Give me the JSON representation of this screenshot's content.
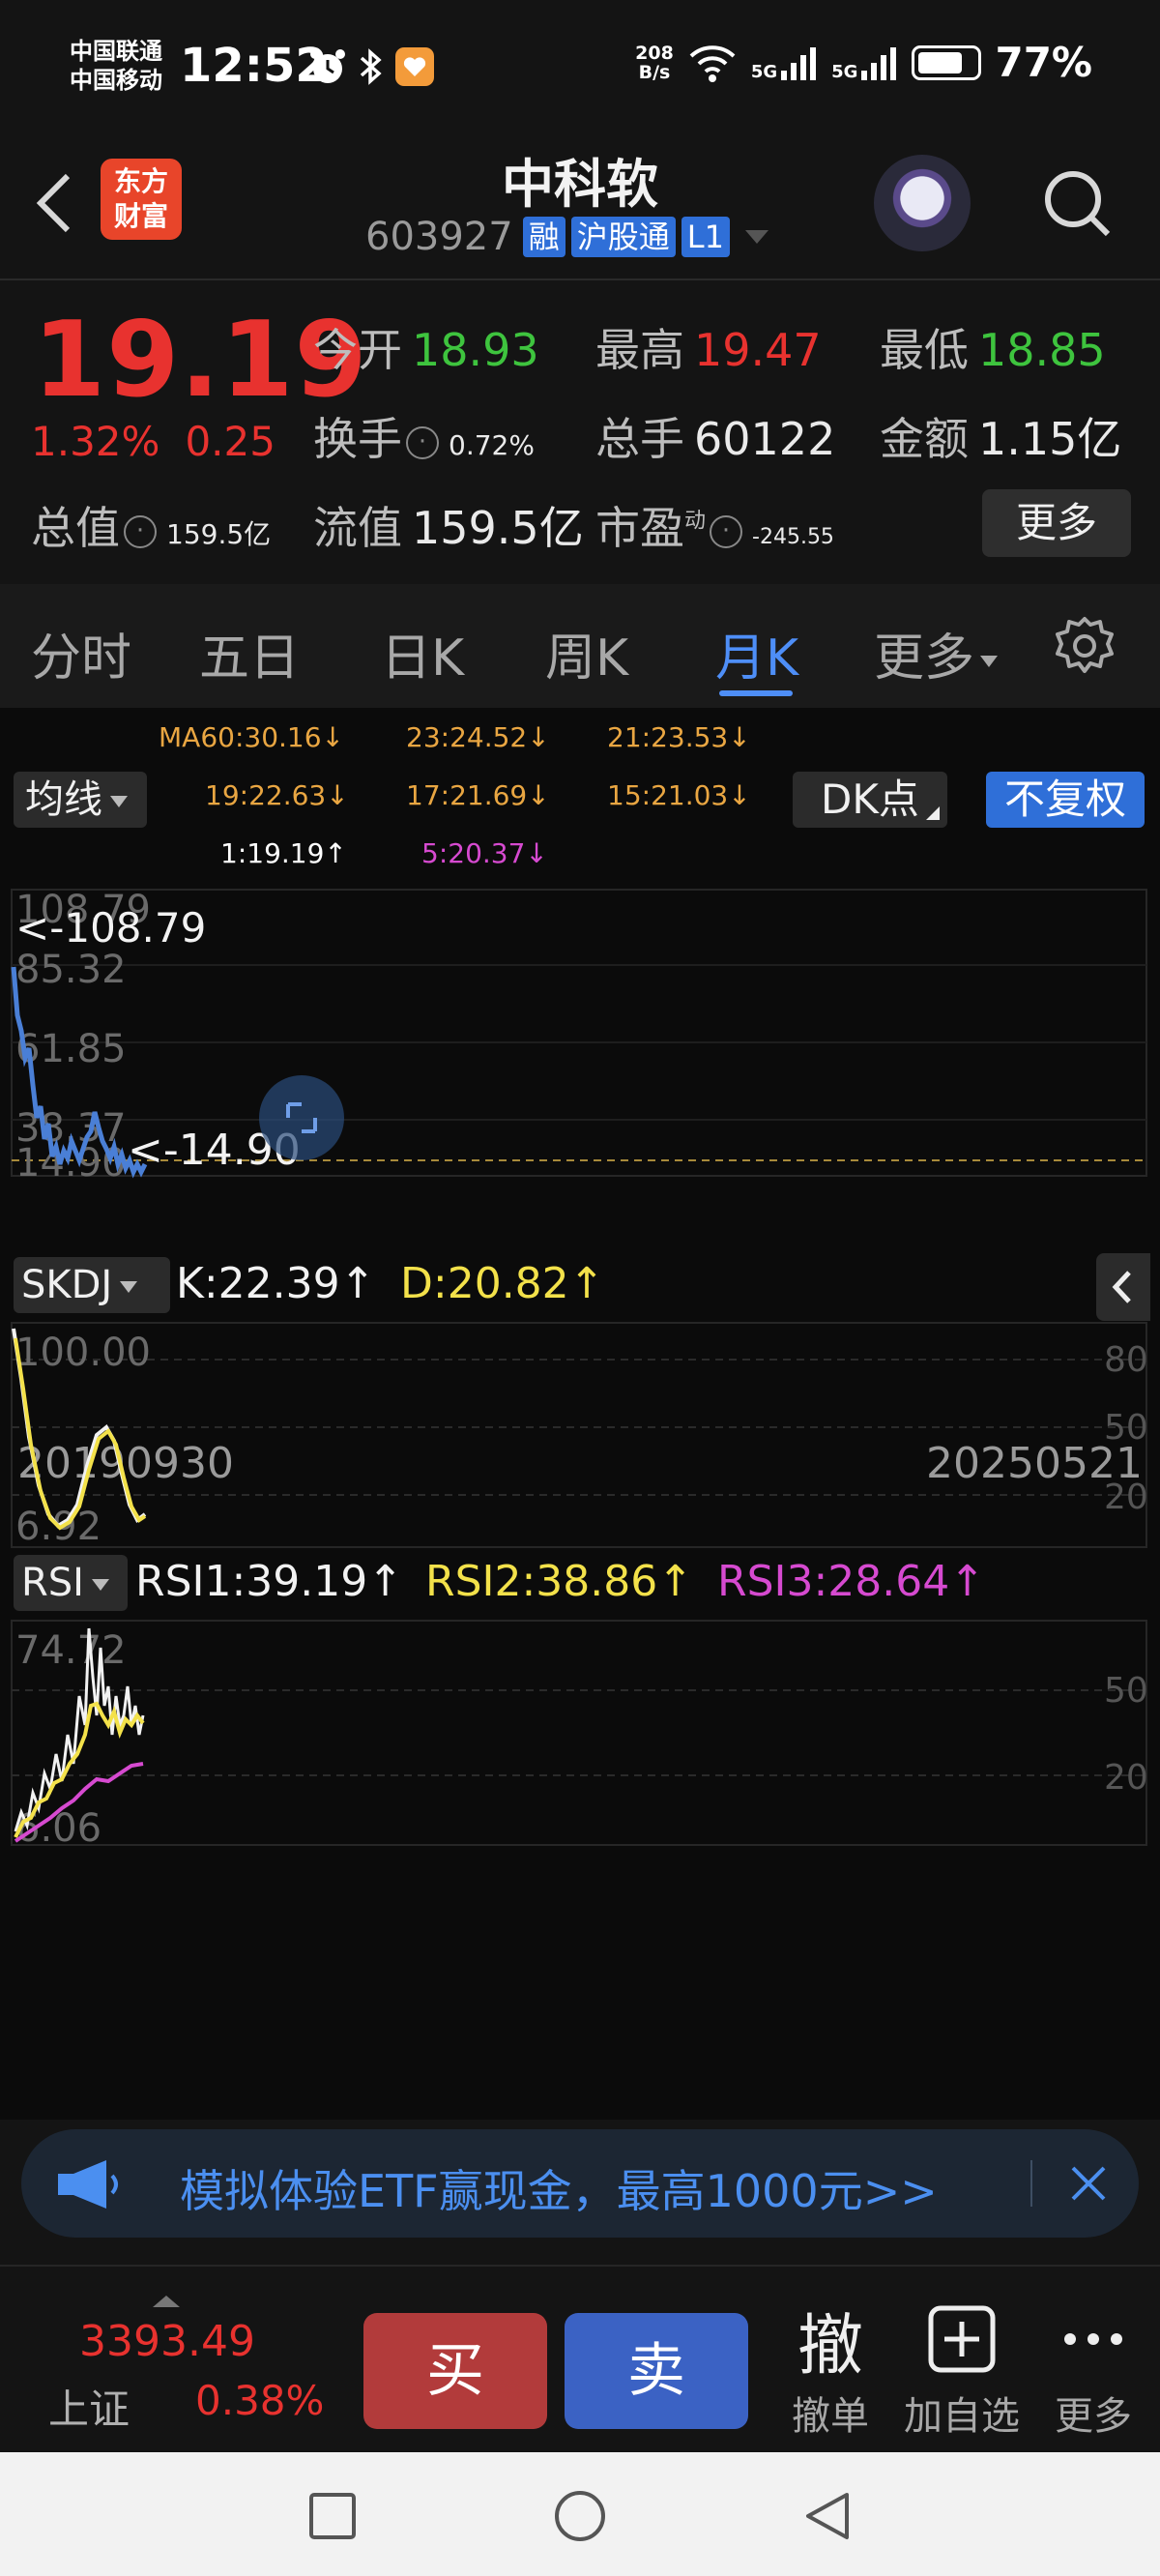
{
  "status_bar": {
    "carrier1": "中国联通",
    "carrier2": "中国移动",
    "time": "12:52",
    "net_speed_value": "208",
    "net_speed_unit": "B/s",
    "signal1_label": "5G",
    "signal2_label": "5G",
    "battery_pct": "77%",
    "battery_level": 0.77
  },
  "header": {
    "logo_line1": "东方",
    "logo_line2": "财富",
    "stock_name": "中科软",
    "stock_code": "603927",
    "tags": [
      "融",
      "沪股通",
      "L1"
    ]
  },
  "quote": {
    "price": "19.19",
    "change_pct": "1.32%",
    "change_amt": "0.25",
    "open_label": "今开",
    "open": "18.93",
    "high_label": "最高",
    "high": "19.47",
    "low_label": "最低",
    "low": "18.85",
    "turnover_label": "换手",
    "turnover": "0.72%",
    "volume_label": "总手",
    "volume": "60122",
    "amount_label": "金额",
    "amount": "1.15亿",
    "mktcap_label": "总值",
    "mktcap": "159.5亿",
    "float_label": "流值",
    "float_cap": "159.5亿",
    "pe_label": "市盈",
    "pe_sup": "动",
    "pe": "-245.55",
    "more_label": "更多"
  },
  "tabs": {
    "items": [
      "分时",
      "五日",
      "日K",
      "周K",
      "月K",
      "更多"
    ],
    "active": "月K"
  },
  "ma": {
    "button": "均线",
    "values": [
      {
        "text": "MA60:30.16↓",
        "color": "#e9a642"
      },
      {
        "text": "23:24.52↓",
        "color": "#e9a642"
      },
      {
        "text": "21:23.53↓",
        "color": "#e9a642"
      },
      {
        "text": "19:22.63↓",
        "color": "#e9a642"
      },
      {
        "text": "17:21.69↓",
        "color": "#e9a642"
      },
      {
        "text": "15:21.03↓",
        "color": "#e9a642"
      },
      {
        "text": "1:19.19↑",
        "color": "#ffffff"
      },
      {
        "text": "5:20.37↓",
        "color": "#d64ad0"
      }
    ],
    "dk_button": "DK点",
    "adjust_button": "不复权"
  },
  "main_chart": {
    "y_labels": [
      "108.79",
      "85.32",
      "61.85",
      "38.37",
      "14.90"
    ],
    "max_marker": "<-108.79",
    "min_marker": "<-14.90",
    "start_date": "20190930",
    "end_date": "20250521",
    "line_color": "#4a7fd6"
  },
  "skdj": {
    "button": "SKDJ",
    "k_text": "K:22.39↑",
    "d_text": "D:20.82↑",
    "y_top": "100.00",
    "y_bottom": "6.92",
    "right_labels": [
      "80",
      "50",
      "20"
    ]
  },
  "rsi": {
    "button": "RSI",
    "rsi1": "RSI1:39.19↑",
    "rsi2": "RSI2:38.86↑",
    "rsi3": "RSI3:28.64↑",
    "y_top": "74.72",
    "y_bottom": "6.06",
    "right_labels": [
      "50",
      "20"
    ]
  },
  "banner": {
    "text": "模拟体验ETF赢现金，最高1000元>>"
  },
  "trade_bar": {
    "index_value": "3393.49",
    "index_name": "上证",
    "index_pct": "0.38%",
    "buy_label": "买",
    "sell_label": "卖",
    "cancel_icon": "撤",
    "cancel_label": "撤单",
    "watch_label": "加自选",
    "more_label": "更多"
  }
}
